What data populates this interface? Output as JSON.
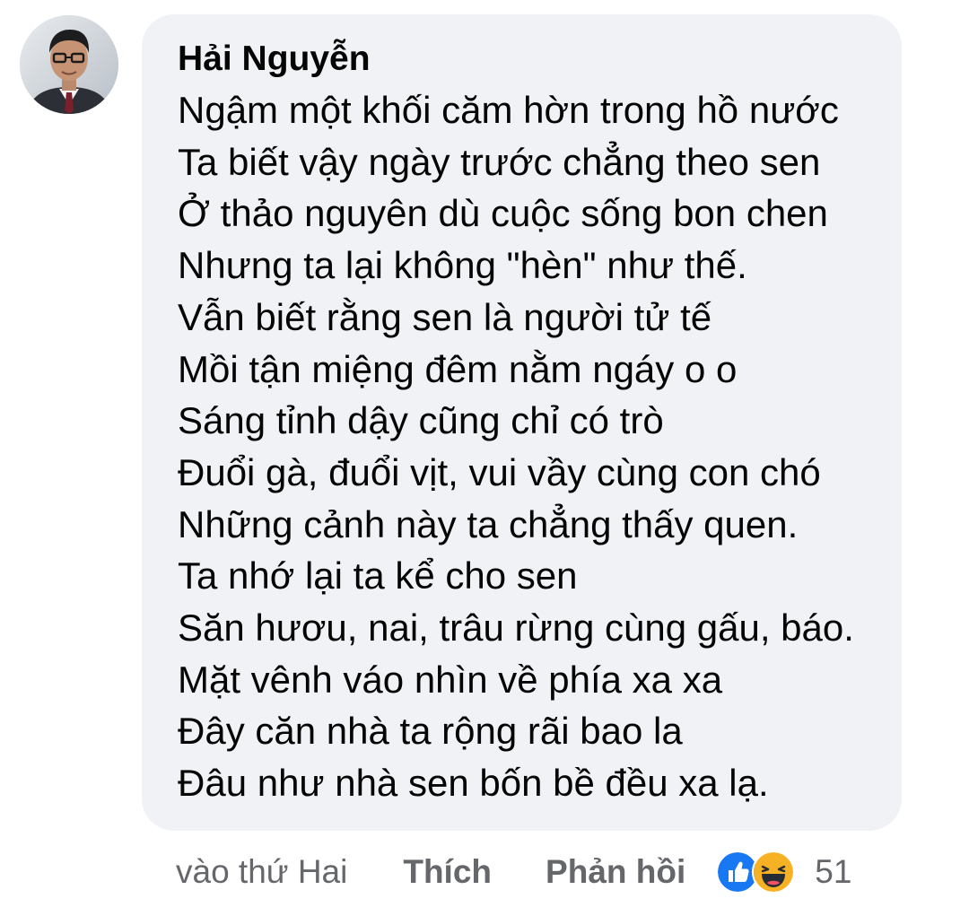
{
  "comment": {
    "author": "Hải Nguyễn",
    "lines": [
      "Ngậm một khối căm hờn trong hồ nước",
      "Ta biết vậy ngày trước chẳng theo sen",
      "Ở thảo nguyên dù cuộc sống bon chen",
      "Nhưng ta lại không \"hèn\" như thế.",
      "Vẫn biết rằng sen là người tử tế",
      "Mồi tận miệng đêm nằm ngáy o o",
      "Sáng tỉnh dậy cũng chỉ có trò",
      "Đuổi gà, đuổi vịt,  vui vầy cùng con chó",
      "Những cảnh này ta chẳng thấy quen.",
      "Ta nhớ lại ta kể cho sen",
      "Săn hươu, nai, trâu rừng cùng gấu, báo.",
      "Mặt vênh váo nhìn về phía xa xa",
      "Đây căn nhà ta rộng rãi bao la",
      "Đâu như nhà sen bốn bề đều xa lạ."
    ]
  },
  "actions": {
    "time": "vào thứ Hai",
    "like_label": "Thích",
    "reply_label": "Phản hồi"
  },
  "reactions": {
    "icons": [
      "like-icon",
      "haha-icon"
    ],
    "count": "51"
  },
  "colors": {
    "bubble": "#f0f2f5",
    "text": "#050505",
    "secondary": "#65676b",
    "like_blue": "#1877f2",
    "haha_yellow": "#f7b125"
  }
}
